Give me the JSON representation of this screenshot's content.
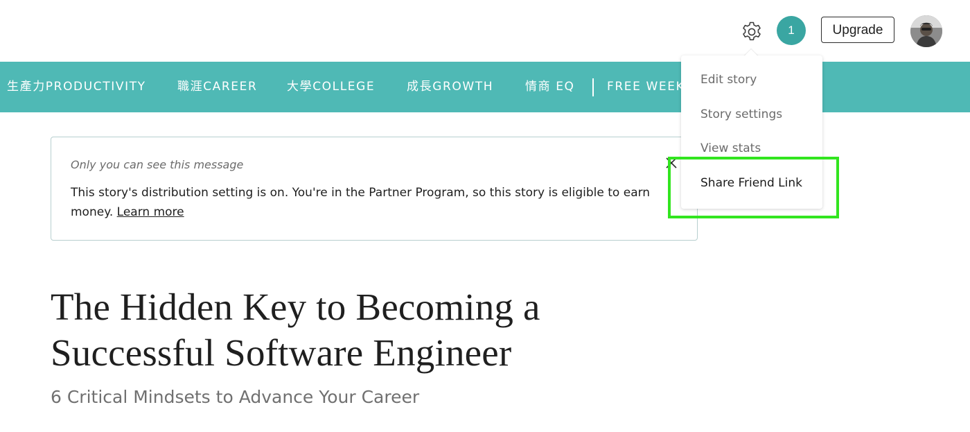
{
  "header": {
    "settings_icon": "gear-icon",
    "notification_count": "1",
    "upgrade_label": "Upgrade",
    "avatar_icon": "user-avatar",
    "accent_color": "#3aa6a2"
  },
  "category_nav": {
    "background_color": "#4fb9b5",
    "items": [
      "生產力PRODUCTIVITY",
      "職涯CAREER",
      "大學COLLEGE",
      "成長GROWTH",
      "情商 EQ",
      "FREE WEEKL"
    ]
  },
  "notice": {
    "visibility_note": "Only you can see this message",
    "body": "This story's distribution setting is on. You're in the Partner Program, so this story is eligible to earn money.",
    "link_label": "Learn more",
    "close_icon": "close-icon"
  },
  "dropdown": {
    "items": [
      "Edit story",
      "Story settings",
      "View stats",
      "Share Friend Link"
    ],
    "highlighted_item": "Share Friend Link",
    "highlight_color": "#32e51f"
  },
  "article": {
    "title": "The Hidden Key to Becoming a Successful Software Engineer",
    "subtitle": "6 Critical Mindsets to Advance Your Career"
  }
}
